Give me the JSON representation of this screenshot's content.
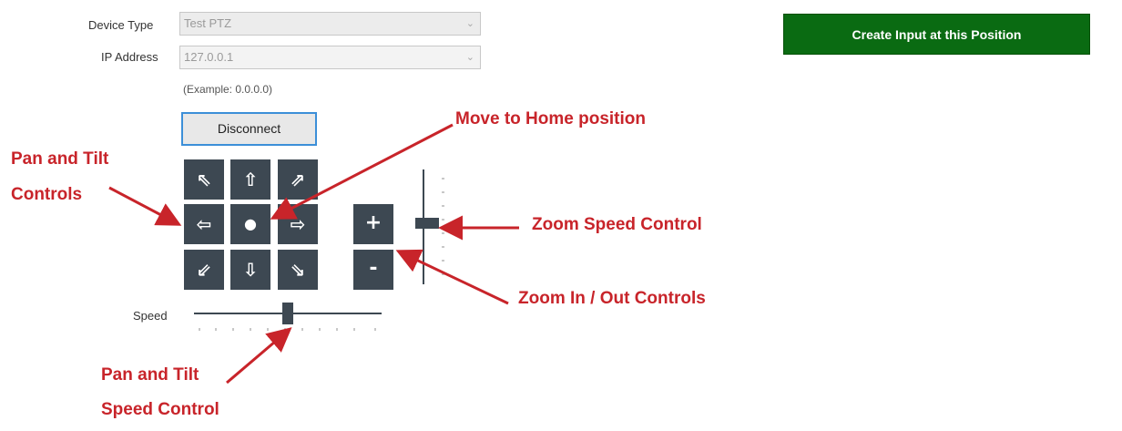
{
  "form": {
    "device_type_label": "Device Type",
    "device_type_value": "Test PTZ",
    "ip_address_label": "IP Address",
    "ip_address_value": "127.0.0.1",
    "ip_example": "(Example: 0.0.0.0)",
    "disconnect_label": "Disconnect"
  },
  "pan_tilt": {
    "up_left": "⇖",
    "up": "⇧",
    "up_right": "⇗",
    "left": "⇦",
    "home": "●",
    "right": "⇨",
    "down_left": "⇙",
    "down": "⇩",
    "down_right": "⇘"
  },
  "zoom": {
    "in_label": "+",
    "out_label": "-"
  },
  "speed": {
    "label": "Speed",
    "value_fraction": 0.5
  },
  "zoom_speed": {
    "value_fraction": 0.47
  },
  "create_button_label": "Create Input at this Position",
  "annotations": {
    "move_home": "Move to Home position",
    "pan_tilt_line1": "Pan and Tilt",
    "pan_tilt_line2": "Controls",
    "zoom_speed": "Zoom Speed Control",
    "zoom_in_out": "Zoom In / Out Controls",
    "pan_tilt_speed_line1": "Pan and Tilt",
    "pan_tilt_speed_line2": "Speed Control"
  },
  "colors": {
    "annotation": "#c8242a",
    "button_dark": "#3d4852",
    "create_green": "#0a6b12",
    "focus_border": "#3c8fd8"
  }
}
